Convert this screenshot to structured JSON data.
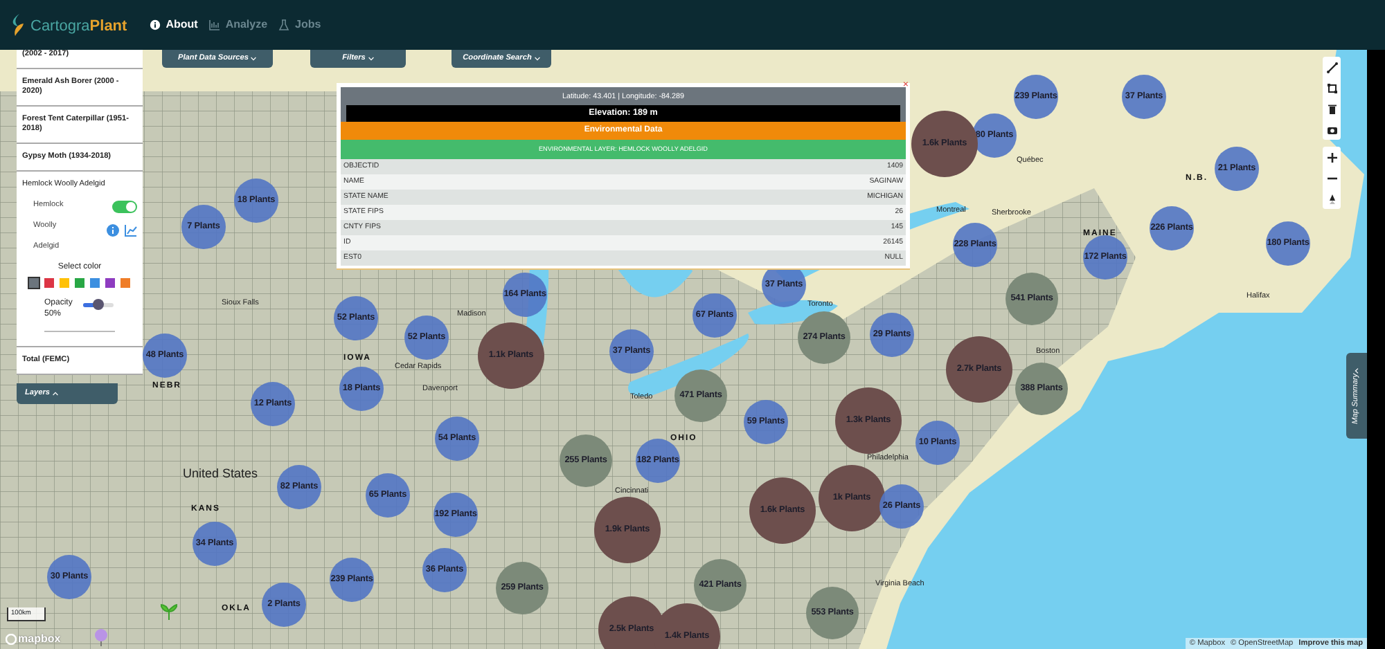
{
  "brand": {
    "prefix": "Cartogra",
    "suffix": "Plant"
  },
  "nav": [
    {
      "label": "About",
      "disabled": false
    },
    {
      "label": "Analyze",
      "disabled": true
    },
    {
      "label": "Jobs",
      "disabled": true
    }
  ],
  "toolbar_tabs": [
    {
      "label": "Plant Data Sources"
    },
    {
      "label": "Filters"
    },
    {
      "label": "Coordinate Search"
    }
  ],
  "layers_panel": {
    "items": [
      {
        "label": "(2002 - 2017)",
        "expanded": false
      },
      {
        "label": "Emerald Ash Borer (2000 - 2020)",
        "expanded": false
      },
      {
        "label": "Forest Tent Caterpillar (1951-2018)",
        "expanded": false
      },
      {
        "label": "Gypsy Moth (1934-2018)",
        "expanded": false
      },
      {
        "label": "Hemlock Woolly Adelgid",
        "expanded": true
      },
      {
        "label": "Total (FEMC)",
        "expanded": false
      }
    ],
    "details": {
      "switch_labels": [
        "Hemlock",
        "Woolly",
        "Adelgid"
      ],
      "on": true,
      "select_color_label": "Select color",
      "colors": [
        {
          "color": "#6c757d",
          "selected": true
        },
        {
          "color": "#dc3545",
          "selected": false
        },
        {
          "color": "#ffc107",
          "selected": false
        },
        {
          "color": "#28a745",
          "selected": false
        },
        {
          "color": "#3c8fe0",
          "selected": false
        },
        {
          "color": "#8e3cc0",
          "selected": false
        },
        {
          "color": "#ef7d28",
          "selected": false
        }
      ],
      "opacity_label": "Opacity",
      "opacity": {
        "level": 0.5
      },
      "opacity_reading": "50%"
    },
    "tab": "Layers"
  },
  "popup": {
    "close": "×",
    "coordinates": "Latitude: 43.401 | Longitude: -84.289",
    "elevation": "Elevation: 189 m",
    "section": "Environmental Data",
    "layer": "ENVIRONMENTAL LAYER: HEMLOCK WOOLLY ADELGID",
    "rows": [
      {
        "key": "OBJECTID",
        "value": "1409"
      },
      {
        "key": "NAME",
        "value": "SAGINAW"
      },
      {
        "key": "STATE NAME",
        "value": "MICHIGAN"
      },
      {
        "key": "STATE FIPS",
        "value": "26"
      },
      {
        "key": "CNTY FIPS",
        "value": "145"
      },
      {
        "key": "ID",
        "value": "26145"
      },
      {
        "key": "EST0",
        "value": "NULL"
      }
    ]
  },
  "map_labels": [
    {
      "text": "United States",
      "kind": "country"
    },
    {
      "text": "Québec",
      "kind": "city"
    },
    {
      "text": "N.B.",
      "kind": "region"
    },
    {
      "text": "MAINE",
      "kind": "region"
    },
    {
      "text": "Montreal",
      "kind": "city"
    },
    {
      "text": "Sherbrooke",
      "kind": "city"
    },
    {
      "text": "Halifax",
      "kind": "city"
    },
    {
      "text": "Toronto",
      "kind": "city"
    },
    {
      "text": "Boston",
      "kind": "city"
    },
    {
      "text": "Philadelphia",
      "kind": "city"
    },
    {
      "text": "Sioux Falls",
      "kind": "city"
    },
    {
      "text": "Madison",
      "kind": "city"
    },
    {
      "text": "Cedar Rapids",
      "kind": "city"
    },
    {
      "text": "Davenport",
      "kind": "city"
    },
    {
      "text": "Toledo",
      "kind": "city"
    },
    {
      "text": "IOWA",
      "kind": "region"
    },
    {
      "text": "NEBR",
      "kind": "region"
    },
    {
      "text": "KANS",
      "kind": "region"
    },
    {
      "text": "OKLA",
      "kind": "region"
    },
    {
      "text": "OHIO",
      "kind": "region"
    },
    {
      "text": "Cincinnati",
      "kind": "city"
    },
    {
      "text": "Virginia Beach",
      "kind": "city"
    }
  ],
  "clusters": [
    {
      "label": "239 Plants",
      "kind": "small"
    },
    {
      "label": "37 Plants",
      "kind": "small"
    },
    {
      "label": "80 Plants",
      "kind": "small"
    },
    {
      "label": "1.6k Plants",
      "kind": "large"
    },
    {
      "label": "21 Plants",
      "kind": "small"
    },
    {
      "label": "18 Plants",
      "kind": "small"
    },
    {
      "label": "7 Plants",
      "kind": "small"
    },
    {
      "label": "226 Plants",
      "kind": "small"
    },
    {
      "label": "180 Plants",
      "kind": "small"
    },
    {
      "label": "228 Plants",
      "kind": "small"
    },
    {
      "label": "172 Plants",
      "kind": "small"
    },
    {
      "label": "37 Plants",
      "kind": "small"
    },
    {
      "label": "164 Plants",
      "kind": "small"
    },
    {
      "label": "541 Plants",
      "kind": "medium"
    },
    {
      "label": "52 Plants",
      "kind": "small"
    },
    {
      "label": "67 Plants",
      "kind": "small"
    },
    {
      "label": "52 Plants",
      "kind": "small"
    },
    {
      "label": "274 Plants",
      "kind": "medium"
    },
    {
      "label": "29 Plants",
      "kind": "small"
    },
    {
      "label": "1.1k Plants",
      "kind": "large"
    },
    {
      "label": "37 Plants",
      "kind": "small"
    },
    {
      "label": "48 Plants",
      "kind": "small"
    },
    {
      "label": "2.7k Plants",
      "kind": "large"
    },
    {
      "label": "388 Plants",
      "kind": "medium"
    },
    {
      "label": "18 Plants",
      "kind": "small"
    },
    {
      "label": "471 Plants",
      "kind": "medium"
    },
    {
      "label": "12 Plants",
      "kind": "small"
    },
    {
      "label": "59 Plants",
      "kind": "small"
    },
    {
      "label": "1.3k Plants",
      "kind": "large"
    },
    {
      "label": "54 Plants",
      "kind": "small"
    },
    {
      "label": "10 Plants",
      "kind": "small"
    },
    {
      "label": "255 Plants",
      "kind": "medium"
    },
    {
      "label": "182 Plants",
      "kind": "small"
    },
    {
      "label": "82 Plants",
      "kind": "small"
    },
    {
      "label": "65 Plants",
      "kind": "small"
    },
    {
      "label": "1k Plants",
      "kind": "large"
    },
    {
      "label": "26 Plants",
      "kind": "small"
    },
    {
      "label": "192 Plants",
      "kind": "small"
    },
    {
      "label": "1.6k Plants",
      "kind": "large"
    },
    {
      "label": "1.9k Plants",
      "kind": "large"
    },
    {
      "label": "34 Plants",
      "kind": "small"
    },
    {
      "label": "36 Plants",
      "kind": "small"
    },
    {
      "label": "30 Plants",
      "kind": "small"
    },
    {
      "label": "239 Plants",
      "kind": "small"
    },
    {
      "label": "259 Plants",
      "kind": "medium"
    },
    {
      "label": "421 Plants",
      "kind": "medium"
    },
    {
      "label": "2 Plants",
      "kind": "small"
    },
    {
      "label": "553 Plants",
      "kind": "medium"
    },
    {
      "label": "2.5k Plants",
      "kind": "large"
    },
    {
      "label": "1.4k Plants",
      "kind": "large"
    }
  ],
  "map_summary_tab": "Map Summary",
  "scale": "100km",
  "logo": "mapbox",
  "attribution": [
    {
      "text": "© Mapbox",
      "link": false
    },
    {
      "text": "© OpenStreetMap",
      "link": false
    },
    {
      "text": "Improve this map",
      "link": true
    }
  ]
}
